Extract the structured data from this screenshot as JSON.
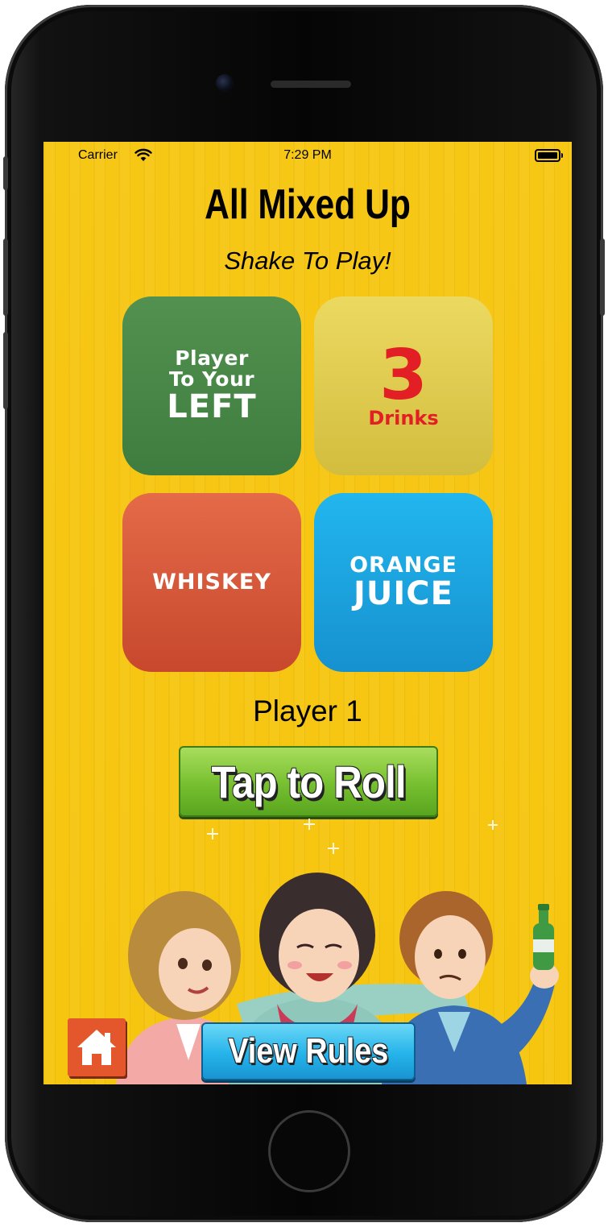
{
  "status_bar": {
    "carrier": "Carrier",
    "time": "7:29 PM"
  },
  "header": {
    "title": "All Mixed Up",
    "subtitle": "Shake To Play!"
  },
  "tiles": {
    "who": {
      "line1": "Player",
      "line2": "To Your",
      "line3": "LEFT",
      "color": "#4a8a4a"
    },
    "amount": {
      "number": "3",
      "unit": "Drinks",
      "color": "#dcc84c"
    },
    "drink": {
      "label": "WHISKEY",
      "color": "#d6583a"
    },
    "mixer": {
      "line1": "ORANGE",
      "line2": "JUICE",
      "color": "#1ea4e0"
    }
  },
  "player": {
    "label": "Player 1"
  },
  "buttons": {
    "roll_label": "Tap to Roll",
    "rules_label": "View Rules"
  },
  "colors": {
    "background": "#f6c50f",
    "roll_button": "#76bf30",
    "rules_button": "#25b3ea",
    "home_button": "#e4572c"
  },
  "icons": {
    "home": "home-icon",
    "wifi": "wifi-icon",
    "battery": "battery-icon"
  }
}
